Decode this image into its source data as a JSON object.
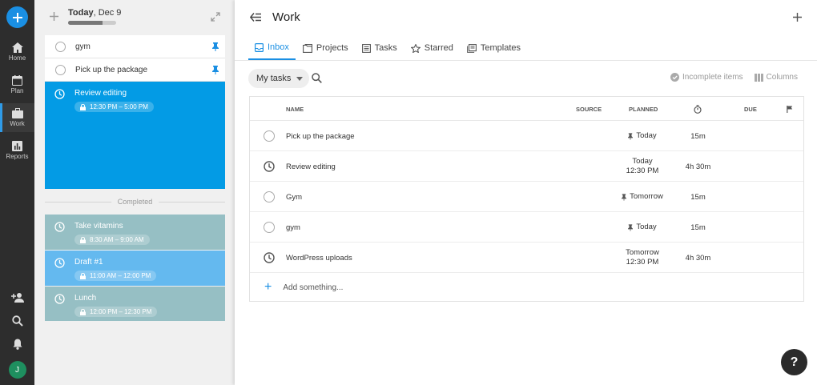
{
  "rail": {
    "items": [
      {
        "label": "Home",
        "icon": "home-icon"
      },
      {
        "label": "Plan",
        "icon": "calendar-icon"
      },
      {
        "label": "Work",
        "icon": "briefcase-icon"
      },
      {
        "label": "Reports",
        "icon": "bar-chart-icon"
      }
    ],
    "avatar_initial": "J"
  },
  "day": {
    "title_bold": "Today",
    "title_rest": ", Dec 9",
    "progress_fraction": 0.72,
    "tasks": [
      {
        "name": "gym"
      },
      {
        "name": "Pick up the package"
      }
    ],
    "events": [
      {
        "name": "Review editing",
        "time": "12:30 PM – 5:00 PM",
        "color": "#039be5"
      },
      {
        "name": "Take vitamins",
        "time": "8:30 AM – 9:00 AM",
        "color": "#96bfc4"
      },
      {
        "name": "Draft #1",
        "time": "11:00 AM – 12:00 PM",
        "color": "#64b9ef"
      },
      {
        "name": "Lunch",
        "time": "12:00 PM – 12:30 PM",
        "color": "#96bfc4"
      }
    ],
    "completed_label": "Completed"
  },
  "main": {
    "title": "Work",
    "tabs": [
      {
        "label": "Inbox",
        "active": true
      },
      {
        "label": "Projects"
      },
      {
        "label": "Tasks"
      },
      {
        "label": "Starred"
      },
      {
        "label": "Templates"
      }
    ],
    "filter_label": "My tasks",
    "incomplete_label": "Incomplete items",
    "columns_label": "Columns",
    "table": {
      "headers": {
        "name": "NAME",
        "source": "SOURCE",
        "planned": "PLANNED",
        "due": "DUE"
      },
      "rows": [
        {
          "status": "circle",
          "name": "Pick up the package",
          "planned_line1": "Today",
          "planned_line2": "",
          "pinned": true,
          "duration": "15m"
        },
        {
          "status": "clock",
          "name": "Review editing",
          "planned_line1": "Today",
          "planned_line2": "12:30 PM",
          "pinned": false,
          "duration": "4h 30m"
        },
        {
          "status": "circle",
          "name": "Gym",
          "planned_line1": "Tomorrow",
          "planned_line2": "",
          "pinned": true,
          "duration": "15m"
        },
        {
          "status": "circle",
          "name": "gym",
          "planned_line1": "Today",
          "planned_line2": "",
          "pinned": true,
          "duration": "15m"
        },
        {
          "status": "clock",
          "name": "WordPress uploads",
          "planned_line1": "Tomorrow",
          "planned_line2": "12:30 PM",
          "pinned": false,
          "duration": "4h 30m"
        }
      ],
      "add_label": "Add something..."
    },
    "help_label": "?"
  },
  "colors": {
    "accent": "#1a8fe3",
    "rail": "#2d2d2d"
  }
}
